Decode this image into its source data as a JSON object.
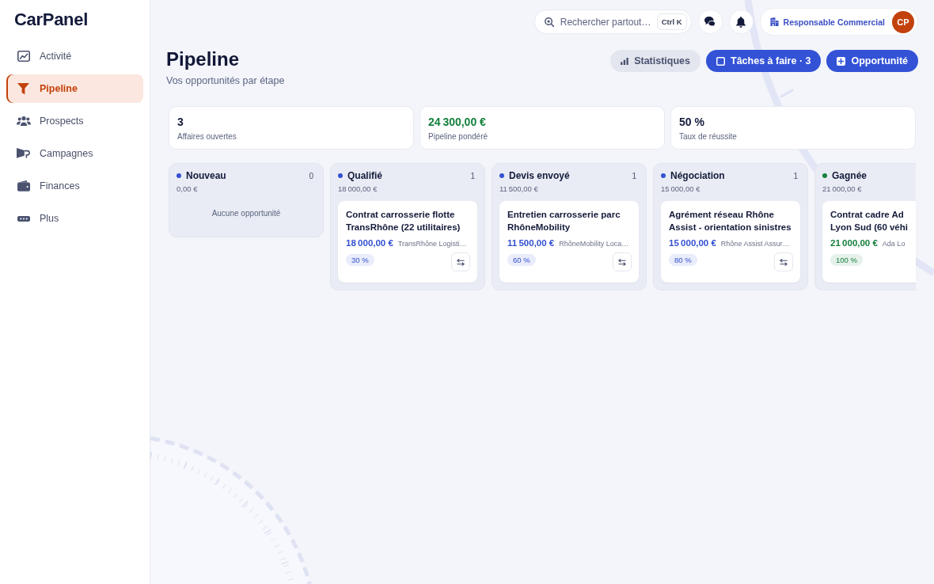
{
  "sidebar": {
    "logo": "CarPanel",
    "items": [
      {
        "label": "Activité",
        "selected": false
      },
      {
        "label": "Pipeline",
        "selected": true
      },
      {
        "label": "Prospects",
        "selected": false
      },
      {
        "label": "Campagnes",
        "selected": false
      },
      {
        "label": "Finances",
        "selected": false
      },
      {
        "label": "Plus",
        "selected": false
      }
    ]
  },
  "topbar": {
    "search": {
      "placeholder": "Rechercher partout…",
      "shortcut": "Ctrl K"
    },
    "user": {
      "role": "Responsable Commercial",
      "initials": "CP"
    }
  },
  "header": {
    "title": "Pipeline",
    "subtitle": "Vos opportunités par étape",
    "actions": [
      {
        "label": "Statistiques",
        "kind": "secondary"
      },
      {
        "label": "Tâches à faire · 3",
        "kind": "primary"
      },
      {
        "label": "Opportunité",
        "kind": "primary"
      }
    ]
  },
  "kpis": [
    {
      "value": "3",
      "label": "Affaires ouvertes",
      "color": "#141a3a"
    },
    {
      "value": "24 300,00 €",
      "label": "Pipeline pondéré",
      "color": "#15803d"
    },
    {
      "value": "50 %",
      "label": "Taux de réussite",
      "color": "#141a3a"
    }
  ],
  "stages": [
    {
      "name": "Nouveau",
      "color": "#3451d1",
      "count": "0",
      "total": "0,00 €",
      "empty_text": "Aucune opportunité"
    },
    {
      "name": "Qualifié",
      "color": "#3451d1",
      "count": "1",
      "total": "18 000,00 €",
      "cards": [
        {
          "title": "Contrat carrosserie flotte TransRhône (22 utilitaires)",
          "amount": "18 000,00 €",
          "company": "TransRhône Logisti…",
          "probability": "30 %",
          "has_move_button": true
        }
      ]
    },
    {
      "name": "Devis envoyé",
      "color": "#3451d1",
      "count": "1",
      "total": "11 500,00 €",
      "cards": [
        {
          "title": "Entretien carrosserie parc RhôneMobility",
          "amount": "11 500,00 €",
          "company": "RhôneMobility Loca…",
          "probability": "60 %",
          "has_move_button": true
        }
      ]
    },
    {
      "name": "Négociation",
      "color": "#3451d1",
      "count": "1",
      "total": "15 000,00 €",
      "cards": [
        {
          "title": "Agrément réseau Rhône Assist - orientation sinistres",
          "amount": "15 000,00 €",
          "company": "Rhône Assist Assur…",
          "probability": "80 %",
          "has_move_button": true
        }
      ]
    },
    {
      "name": "Gagnée",
      "color": "#15803d",
      "total": "21 000,00 €",
      "cards": [
        {
          "title": "Contrat cadre Ad Lyon Sud (60 véhi",
          "amount": "21 000,00 €",
          "company": "Ada Lo",
          "probability": "100 %",
          "has_move_button": false
        }
      ]
    }
  ]
}
